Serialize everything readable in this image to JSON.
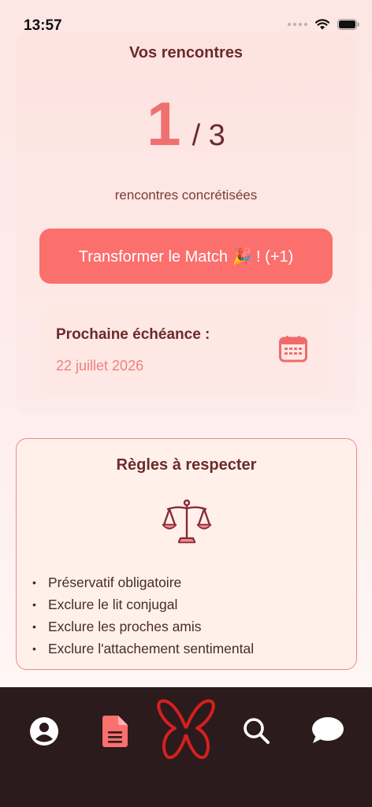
{
  "status_bar": {
    "time": "13:57"
  },
  "header": {
    "title": "Vos rencontres"
  },
  "counter": {
    "current": "1",
    "total": "/ 3",
    "label": "rencontres concrétisées"
  },
  "cta": {
    "label": "Transformer le Match 🎉 ! (+1)"
  },
  "deadline": {
    "label": "Prochaine échéance :",
    "date": "22 juillet 2026",
    "icon": "calendar-icon"
  },
  "rules": {
    "title": "Règles à respecter",
    "icon": "scale-icon",
    "items": [
      "Préservatif obligatoire",
      "Exclure le lit conjugal",
      "Exclure les proches amis",
      "Exclure l'attachement sentimental"
    ]
  },
  "tabbar": {
    "items": [
      "profile-icon",
      "document-icon",
      "butterfly-logo",
      "search-icon",
      "chat-icon"
    ]
  },
  "colors": {
    "accent": "#fb6f6d",
    "text": "#6b2b2b",
    "tabbar": "#2b1b1c",
    "logo": "#d42020"
  }
}
